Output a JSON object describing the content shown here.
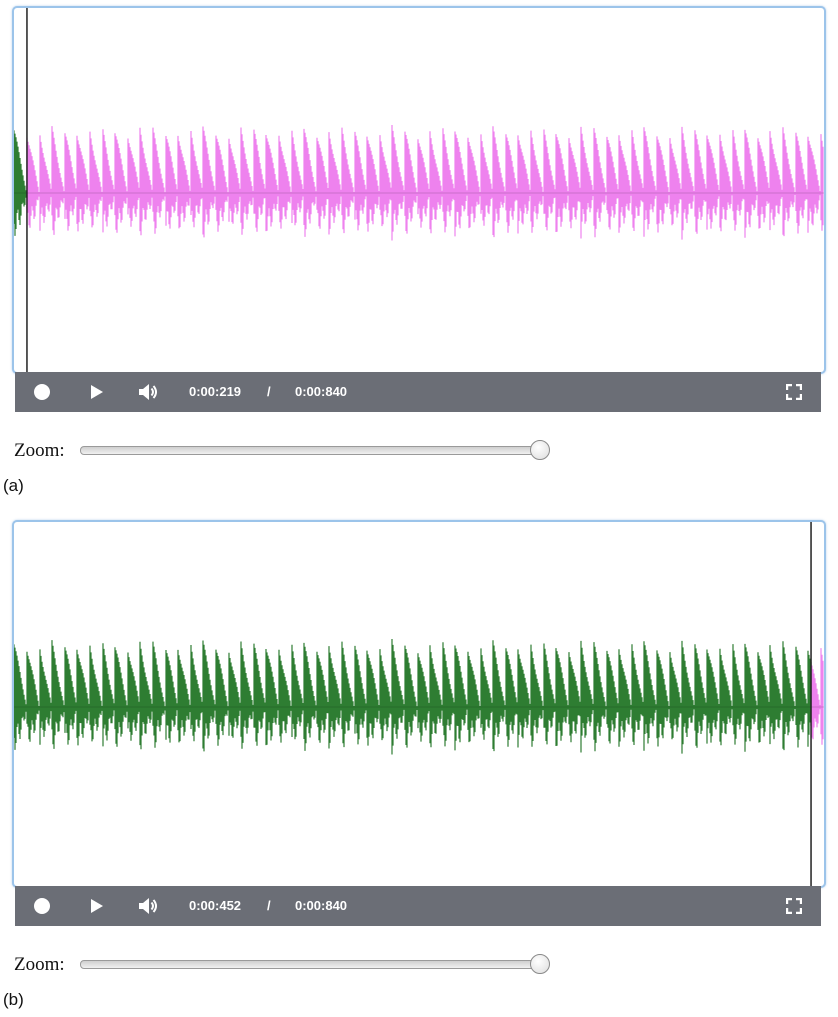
{
  "panels": [
    {
      "label": "(a)",
      "player": {
        "current_time": "0:00:219",
        "separator": "/",
        "total_time": "0:00:840",
        "playhead_fraction": 0.016,
        "played_color": "#2e7d32",
        "unplayed_color": "#ee82ee"
      },
      "controls": {
        "record_icon": "record-icon",
        "play_icon": "play-icon",
        "volume_icon": "volume-icon",
        "fullscreen_icon": "fullscreen-icon"
      },
      "zoom": {
        "label": "Zoom:",
        "value_fraction": 1.0
      }
    },
    {
      "label": "(b)",
      "player": {
        "current_time": "0:00:452",
        "separator": "/",
        "total_time": "0:00:840",
        "playhead_fraction": 0.984,
        "played_color": "#2e7d32",
        "unplayed_color": "#ee82ee"
      },
      "controls": {
        "record_icon": "record-icon",
        "play_icon": "play-icon",
        "volume_icon": "volume-icon",
        "fullscreen_icon": "fullscreen-icon"
      },
      "zoom": {
        "label": "Zoom:",
        "value_fraction": 1.0
      }
    }
  ]
}
